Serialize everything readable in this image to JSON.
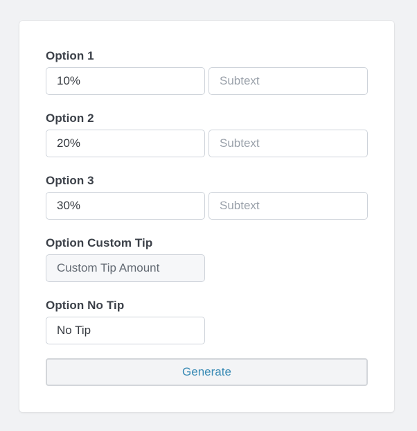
{
  "form": {
    "options": [
      {
        "label": "Option 1",
        "value": "10%",
        "subtext_value": "",
        "subtext_placeholder": "Subtext"
      },
      {
        "label": "Option 2",
        "value": "20%",
        "subtext_value": "",
        "subtext_placeholder": "Subtext"
      },
      {
        "label": "Option 3",
        "value": "30%",
        "subtext_value": "",
        "subtext_placeholder": "Subtext"
      }
    ],
    "custom_tip": {
      "label": "Option Custom Tip",
      "value": "Custom Tip Amount"
    },
    "no_tip": {
      "label": "Option No Tip",
      "value": "No Tip"
    },
    "generate_label": "Generate"
  },
  "colors": {
    "page_background": "#f1f2f4",
    "card_background": "#ffffff",
    "label_text": "#3b4048",
    "input_border": "#ced3da",
    "placeholder_text": "#9aa1aa",
    "readonly_background": "#f6f7f9",
    "button_text": "#3a8bb5",
    "button_background": "#f3f4f6"
  }
}
